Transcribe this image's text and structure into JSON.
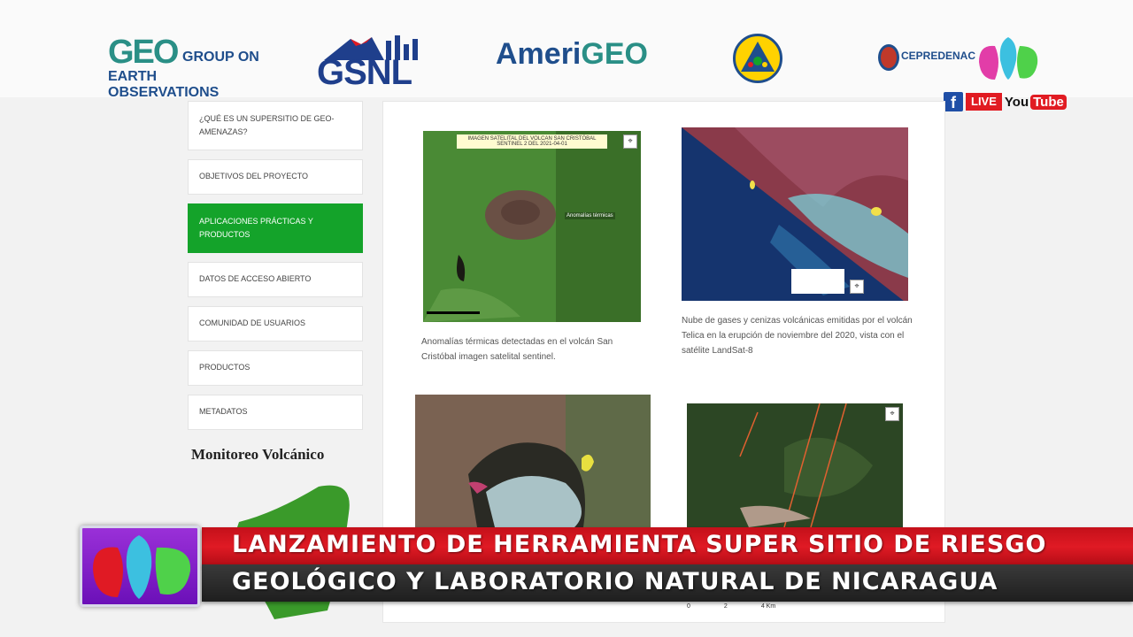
{
  "header": {
    "geo_logo": {
      "mark": "GEO",
      "line1": "GROUP ON",
      "line2": "EARTH OBSERVATIONS"
    },
    "gsnl_logo": "GSNL",
    "amerigeo_logo": {
      "part1": "Ameri",
      "part2": "GEO"
    },
    "cepredenac_logo": "CEPREDENAC"
  },
  "channel": {
    "live": "LIVE",
    "youtube_you": "You",
    "youtube_tube": "Tube",
    "facebook": "f"
  },
  "sidebar": {
    "items": [
      {
        "label": "¿Qué es un supersitio de geo-amenazas?",
        "active": false
      },
      {
        "label": "Objetivos del proyecto",
        "active": false
      },
      {
        "label": "Aplicaciones prácticas y productos",
        "active": true
      },
      {
        "label": "Datos de acceso abierto",
        "active": false
      },
      {
        "label": "Comunidad de usuarios",
        "active": false
      },
      {
        "label": "Productos",
        "active": false
      },
      {
        "label": "Metadatos",
        "active": false
      }
    ],
    "section_title": "Monitoreo Volcánico"
  },
  "content": {
    "figures": [
      {
        "title_line1": "IMAGEN SATELITAL DEL VOLCAN SAN CRISTÓBAL",
        "title_line2": "SENTINEL 2 DEL 2021-04-01",
        "label": "Anomalías térmicas",
        "caption": "Anomalías térmicas detectadas en el volcán San Cristóbal imagen satelital sentinel."
      },
      {
        "caption": "Nube de gases y cenizas volcánicas emitidas por el volcán Telica en la erupción de noviembre del 2020, vista con el satélite LandSat-8"
      },
      {
        "caption": ""
      },
      {
        "scale": [
          "0",
          "2",
          "4 Km"
        ]
      }
    ]
  },
  "lower_third": {
    "line1": "LANZAMIENTO DE HERRAMIENTA SUPER SITIO DE RIESGO",
    "line2": "GEOLÓGICO Y LABORATORIO NATURAL DE NICARAGUA"
  },
  "colors": {
    "accent_green": "#14a32a",
    "banner_red": "#e01a24",
    "banner_dark": "#2a2a2a",
    "logo_purple": "#8a24d0"
  }
}
